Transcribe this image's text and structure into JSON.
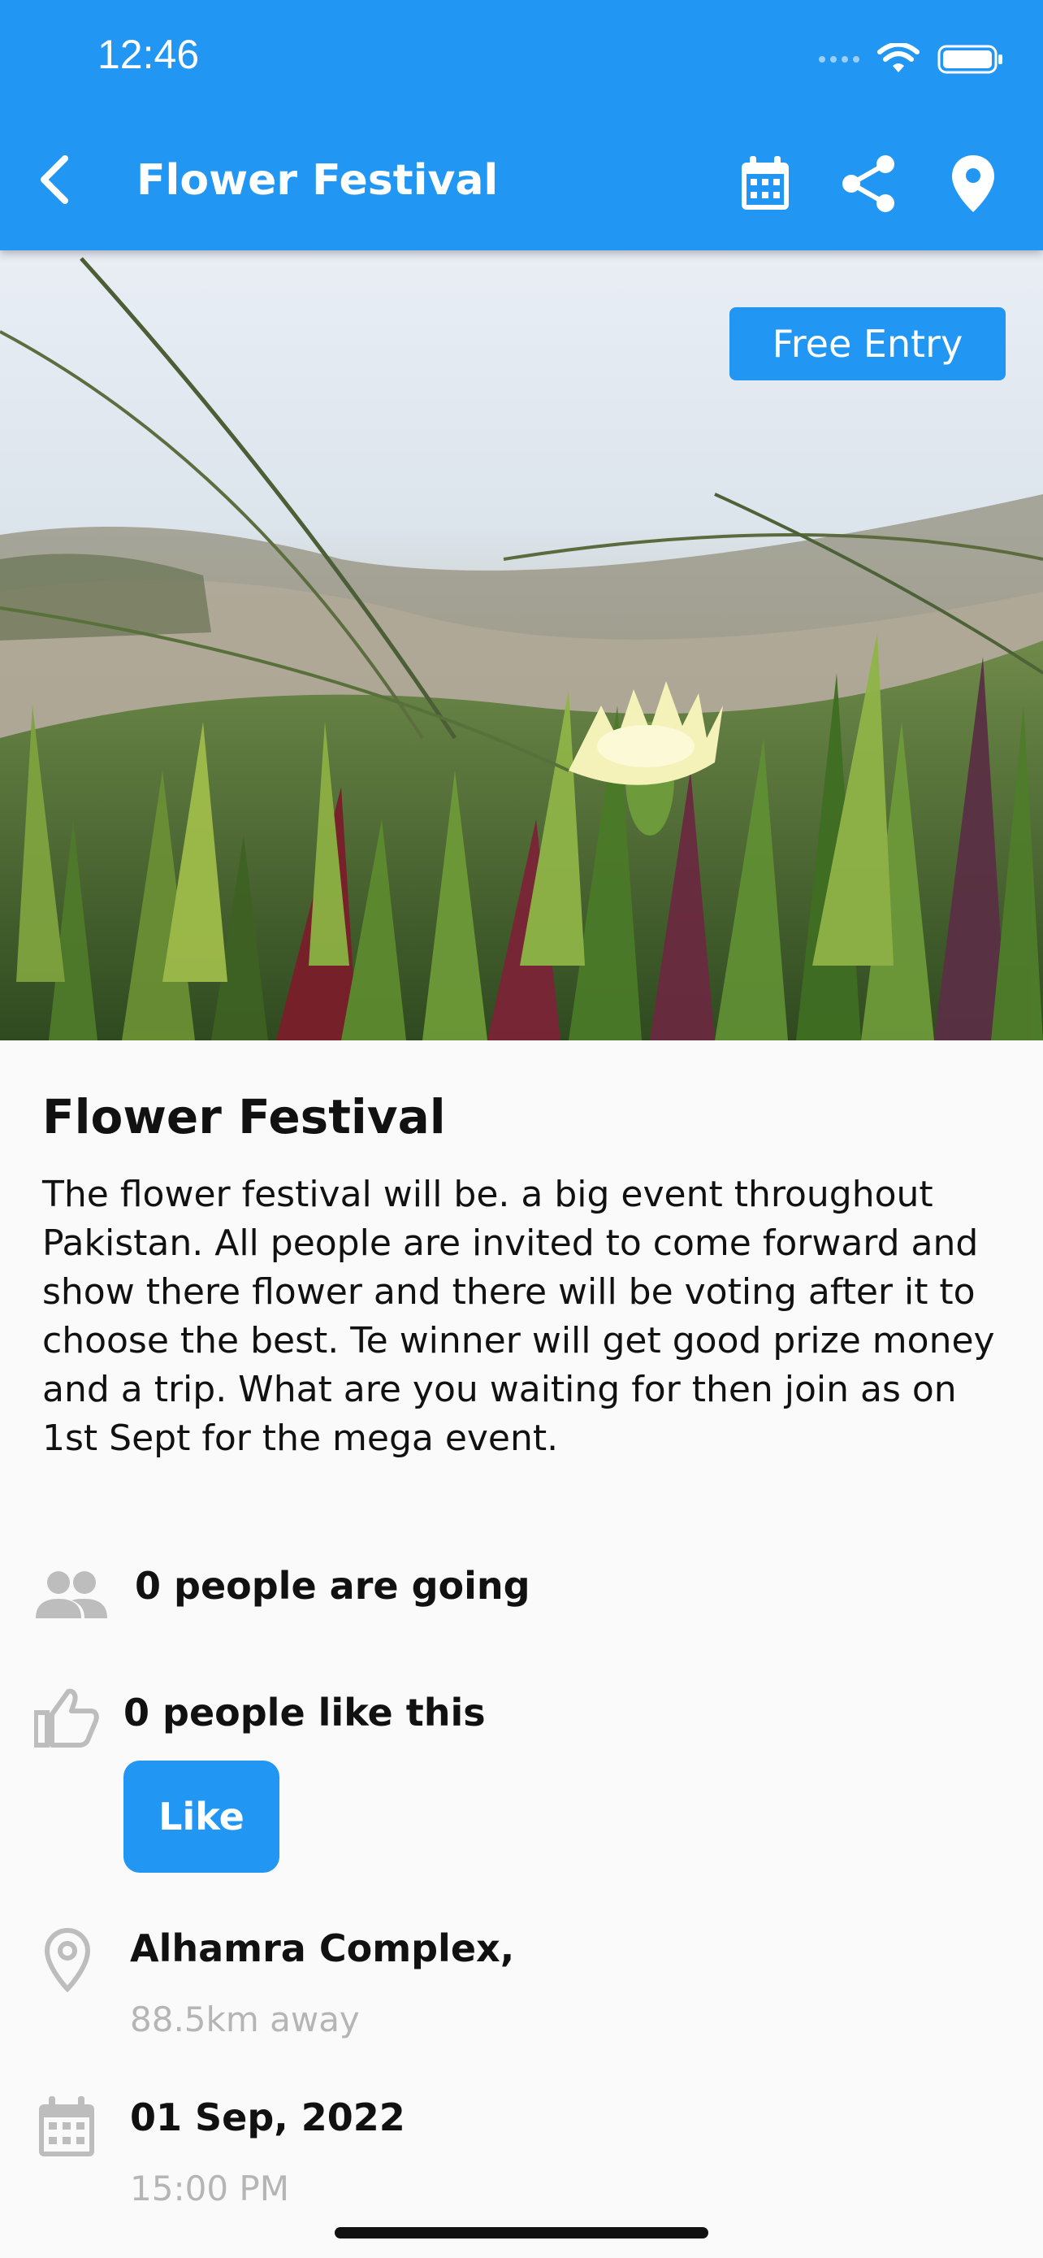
{
  "status_bar": {
    "time": "12:46"
  },
  "app_bar": {
    "title": "Flower Festival",
    "back_icon": "chevron-left-icon",
    "actions": [
      "calendar-icon",
      "share-icon",
      "location-pin-icon"
    ],
    "color": "#2196f3"
  },
  "hero": {
    "badge": "Free Entry"
  },
  "event": {
    "title": "Flower Festival",
    "description": "The flower festival will be. a big event throughout Pakistan. All people are invited to come forward and show there flower and there will be voting after it to choose the best. Te winner will get good prize money and a trip. What are you waiting for then join as on 1st Sept for the mega event.",
    "going_text": "0 people are going",
    "likes_text": "0 people like this",
    "like_button": "Like",
    "location_name": "Alhamra Complex,",
    "distance": "88.5km away",
    "date": "01 Sep, 2022",
    "time": "15:00 PM"
  },
  "colors": {
    "accent": "#2196f3",
    "muted": "#b5b5b5",
    "icon_gray": "#bdbdbd"
  }
}
